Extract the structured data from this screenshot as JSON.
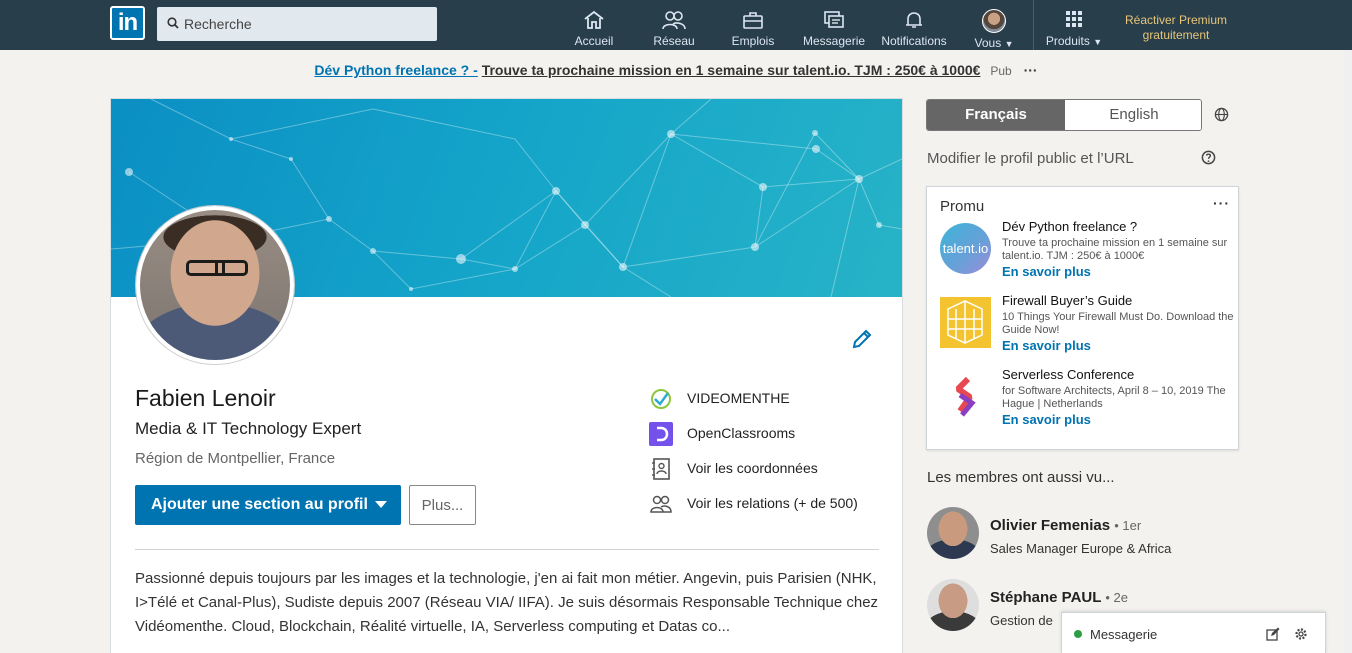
{
  "nav": {
    "logo_text": "in",
    "search_placeholder": "Recherche",
    "items": [
      {
        "label": "Accueil"
      },
      {
        "label": "Réseau"
      },
      {
        "label": "Emplois"
      },
      {
        "label": "Messagerie"
      },
      {
        "label": "Notifications"
      },
      {
        "label": "Vous"
      },
      {
        "label": "Produits"
      }
    ],
    "premium_line1": "Réactiver Premium",
    "premium_line2": "gratuitement"
  },
  "adbar": {
    "title": "Dév Python freelance ? -",
    "text": "Trouve ta prochaine mission en 1 semaine sur talent.io. TJM : 250€ à 1000€",
    "pub": "Pub",
    "dots": "···"
  },
  "profile": {
    "name": "Fabien Lenoir",
    "headline": "Media & IT Technology Expert",
    "location": "Région de Montpellier, France",
    "add_section_label": "Ajouter une section au profil",
    "more_label": "Plus...",
    "side": [
      {
        "label": "VIDEOMENTHE"
      },
      {
        "label": "OpenClassrooms"
      },
      {
        "label": "Voir les coordonnées"
      },
      {
        "label": "Voir les relations (+ de 500)"
      }
    ],
    "summary": "Passionné depuis toujours par les images et la technologie, j'en ai fait mon métier. Angevin, puis Parisien (NHK, I>Télé et Canal-Plus), Sudiste depuis 2007 (Réseau VIA/ IIFA). Je suis désormais Responsable Technique chez Vidéomenthe. Cloud, Blockchain, Réalité virtuelle, IA, Serverless computing et Datas co..."
  },
  "right": {
    "lang_fr": "Français",
    "lang_en": "English",
    "public_profile": "Modifier le profil public et l’URL",
    "promo_head": "Promu",
    "promo_more": "···",
    "promos": [
      {
        "title": "Dév Python freelance ?",
        "desc": "Trouve ta prochaine mission en 1 semaine sur talent.io. TJM : 250€ à 1000€",
        "link": "En savoir plus",
        "thumb": "talent.io"
      },
      {
        "title": "Firewall Buyer’s Guide",
        "desc": "10 Things Your Firewall Must Do. Download the Guide Now!",
        "link": "En savoir plus"
      },
      {
        "title": "Serverless Conference",
        "desc": "for Software Architects, April 8 – 10, 2019 The Hague | Netherlands",
        "link": "En savoir plus"
      }
    ],
    "members_head": "Les membres ont aussi vu...",
    "members": [
      {
        "name": "Olivier Femenias",
        "degree": "• 1er",
        "job": "Sales Manager Europe & Africa"
      },
      {
        "name": "Stéphane PAUL",
        "degree": "• 2e",
        "job": "Gestion de"
      }
    ]
  },
  "messaging": {
    "label": "Messagerie"
  },
  "colors": {
    "nav_bg": "#283e4a",
    "brand": "#0073b1",
    "premium": "#e7c57a"
  }
}
